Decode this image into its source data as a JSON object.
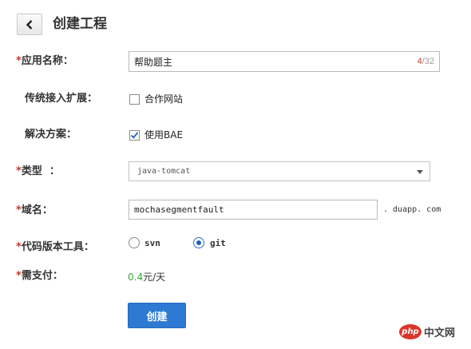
{
  "header": {
    "title": "创建工程"
  },
  "colors": {
    "required": "#c0392b",
    "primary_button": "#2e7ad3",
    "price_number": "#3aa935"
  },
  "form": {
    "required_mark": "*",
    "app_name": {
      "label": "应用名称：",
      "value": "帮助题主",
      "count": "4",
      "max": "/32"
    },
    "traditional_access": {
      "label": "传统接入扩展：",
      "option_label": "合作网站",
      "checked": false
    },
    "solution": {
      "label": "解决方案：",
      "option_label": "使用BAE",
      "checked": true
    },
    "type": {
      "label": "类型  ：",
      "selected": "java-tomcat"
    },
    "domain": {
      "label": "域名：",
      "value": "mochasegmentfault",
      "suffix": ". duapp. com"
    },
    "vcs": {
      "label": "代码版本工具：",
      "options": [
        {
          "label": "svn",
          "selected": false
        },
        {
          "label": "git",
          "selected": true
        }
      ]
    },
    "cost": {
      "label": "需支付：",
      "amount": "0.4",
      "unit": "元/天"
    },
    "submit_label": "创建"
  },
  "watermark": {
    "logo_text": "php",
    "site_text": "中文网"
  }
}
